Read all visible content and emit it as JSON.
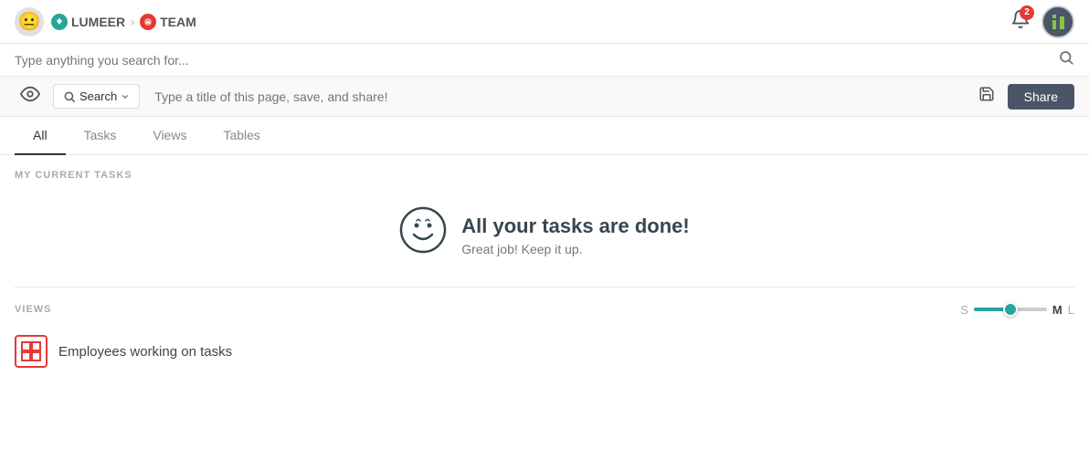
{
  "topNav": {
    "userAvatar": "😐",
    "breadcrumb": [
      {
        "label": "LUMEER",
        "iconType": "lumeer"
      },
      {
        "label": "TEAM",
        "iconType": "team"
      }
    ],
    "bellBadge": "2"
  },
  "searchBar": {
    "placeholder": "Type anything you search for...",
    "iconLabel": "search"
  },
  "toolbar": {
    "eyeLabel": "👁",
    "searchDropdownLabel": "Search",
    "titlePlaceholder": "Type a title of this page, save, and share!",
    "saveLabel": "💾",
    "shareLabel": "Share"
  },
  "tabs": [
    {
      "label": "All",
      "active": true
    },
    {
      "label": "Tasks",
      "active": false
    },
    {
      "label": "Views",
      "active": false
    },
    {
      "label": "Tables",
      "active": false
    }
  ],
  "currentTasksSection": {
    "label": "MY CURRENT TASKS",
    "doneTitle": "All your tasks are done!",
    "doneSubtitle": "Great job! Keep it up."
  },
  "viewsSection": {
    "label": "VIEWS",
    "sizeOptions": [
      {
        "label": "S",
        "active": false
      },
      {
        "label": "M",
        "active": true
      },
      {
        "label": "L",
        "active": false
      }
    ],
    "items": [
      {
        "name": "Employees working on tasks",
        "iconType": "grid"
      }
    ]
  }
}
